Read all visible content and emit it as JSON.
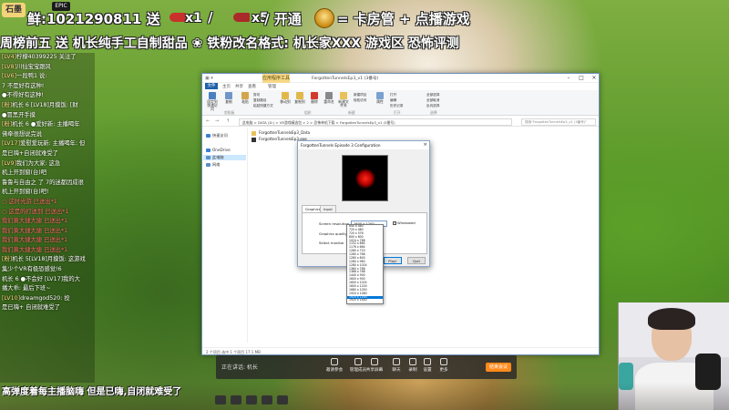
{
  "stream": {
    "logo_text": "石墨",
    "epic_tag": "EPIC",
    "banner_gift": "鲜:1021290811 送",
    "gift1_count": "x1",
    "slash": "/",
    "gift2_count": "x5",
    "open_label": "/ 开通",
    "open_reward": "= 卡房管 + 点播游戏",
    "line2": "周榜前五 送 机长纯手工自制甜品 ❀ 铁粉改名格式: 机长家XXX 游戏区 恐怖评测",
    "bottom_message": "高弹度着每主播脑嗨 但是已嗨,自闭就难受了"
  },
  "chat": [
    {
      "lv": "[LV4]",
      "text": "柠檬40399225 关注了"
    },
    {
      "lv": "[LV8]",
      "text": "川仙宝宝跟风"
    },
    {
      "lv": "[LV6]",
      "text": "一段鸭1 说:"
    },
    {
      "lv": "",
      "text": "  7 不是好有这种!"
    },
    {
      "lv": "",
      "text": "  ●不得好有这种!"
    },
    {
      "lv": "[粉]",
      "text": "机长 6 [LV18]月摸饭: [财"
    },
    {
      "lv": "",
      "text": "  ●冒黑开手摸"
    },
    {
      "lv": "[粉]",
      "text": "机长 6 ●爱好新: 主播喝年"
    },
    {
      "lv": "",
      "text": "  佛牵很想说完说"
    },
    {
      "lv": "[LV17]",
      "text": "爱慰爱玩新: 主播喝年: 但"
    },
    {
      "lv": "",
      "text": "  是已嗨+自闭就难受了"
    },
    {
      "lv": "[LV9]",
      "text": "我们为大家: 这急"
    },
    {
      "lv": "",
      "text": "  机上开到窗(台)吧"
    },
    {
      "lv": "",
      "text": "  鲁鲁与自由之 了 7的迷都因成很"
    },
    {
      "lv": "",
      "text": "  机上开到窗(台)吧!"
    },
    {
      "lv": "",
      "text": " "
    },
    {
      "lv": "",
      "text": "  ○ 这时光游 已送出*1"
    },
    {
      "lv": "",
      "text": "  ○ 这是的打送到 已送出*1"
    },
    {
      "lv": "",
      "text": "  我们黄大捷大捷 已送出*1"
    },
    {
      "lv": "",
      "text": "  我们黄大捷大捷 已送出*1"
    },
    {
      "lv": "",
      "text": "  我们黄大捷大捷 已送出*1"
    },
    {
      "lv": "",
      "text": "  我们黄大捷大捷 已送出*1"
    },
    {
      "lv": "",
      "text": " "
    },
    {
      "lv": "[粉]",
      "text": "机长 5[LV18]月摸饭: 这游戏"
    },
    {
      "lv": "",
      "text": "  集少个VR有极恐感觉!6"
    },
    {
      "lv": "",
      "text": "  机长 6 ●不会好 [LV17]我的大"
    },
    {
      "lv": "",
      "text": "  播大乖: 最后下班~"
    },
    {
      "lv": "[LV10]",
      "text": "dreamgod520: 投"
    },
    {
      "lv": "",
      "text": "  是已嗨+ 自闭就难受了"
    }
  ],
  "explorer": {
    "title": "ForgottenTunnelsEp3_v1 (3番号)",
    "ctx_tab": "应用程序工具",
    "ribbon_tabs": {
      "file": "文件",
      "home": "主页",
      "share": "共享",
      "view": "查看",
      "manage": "管理"
    },
    "ribbon_buttons": [
      {
        "label": "固定到快速访问",
        "color": "#4a7fc1"
      },
      {
        "label": "复制",
        "color": "#6e96c8"
      },
      {
        "label": "粘贴",
        "color": "#d3a64a"
      },
      {
        "label": "移动到",
        "color": "#e0b84a"
      },
      {
        "label": "复制到",
        "color": "#e0b84a"
      },
      {
        "label": "删除",
        "color": "#d33a2c"
      },
      {
        "label": "重命名",
        "color": "#888"
      },
      {
        "label": "新建文件夹",
        "color": "#e8c15a"
      },
      {
        "label": "属性",
        "color": "#7aa0d0"
      }
    ],
    "ribbon_small": [
      "剪切",
      "复制路径",
      "粘贴快捷方式",
      "新建项目",
      "轻松访问",
      "打开",
      "编辑",
      "历史记录",
      "全部选择",
      "全部取消",
      "反向选择"
    ],
    "ribbon_groups": [
      "剪贴板",
      "组织",
      "新建",
      "打开",
      "选择"
    ],
    "nav_buttons": {
      "back": "←",
      "forward": "→",
      "up": "↑"
    },
    "address": "此电脑 > DATA (D:) > VR游戏精选包 > 2 > 恐怖单机下载 > ForgottenTunnelsEp3_v1 (3番号)",
    "search_placeholder": "搜索\"ForgottenTunnelsEp3_v1 (3番号)\"",
    "nav_items": [
      {
        "label": "快速访问",
        "color": "#3a7fd0"
      },
      {
        "label": "OneDrive",
        "color": "#3a7fd0"
      },
      {
        "label": "此电脑",
        "color": "#5c8ec9"
      },
      {
        "label": "网络",
        "color": "#5c8ec9"
      }
    ],
    "files": [
      {
        "name": "ForgottenTunnelsEp3_Data",
        "color": "#e8c15a"
      },
      {
        "name": "ForgottenTunnelsEp3.exe",
        "color": "#333"
      }
    ],
    "status": "2 个项目  选中 1 个项目  17.1 MB",
    "window_controls": {
      "min": "–",
      "max": "□",
      "close": "×"
    }
  },
  "config": {
    "title": "ForgottenTunnels Episode 3 Configuration",
    "close": "×",
    "tabs": [
      "Graphics",
      "Input"
    ],
    "labels": {
      "resolution": "Screen resolution",
      "quality": "Graphics quality",
      "monitor": "Select monitor"
    },
    "resolution_value": "1600 x 1200",
    "windowed_label": "Windowed",
    "windowed_mark": "✓",
    "buttons": {
      "play": "Play!",
      "quit": "Quit"
    },
    "resolutions": [
      "640 x 480",
      "720 x 480",
      "720 x 576",
      "800 x 600",
      "1024 x 768",
      "1152 x 864",
      "1176 x 664",
      "1280 x 720",
      "1280 x 768",
      "1280 x 800",
      "1280 x 960",
      "1280 x 1024",
      "1360 x 768",
      "1366 x 768",
      "1440 x 900",
      "1600 x 900",
      "1600 x 1024",
      "1600 x 1200",
      "1680 x 1050",
      "1920 x 1080",
      "1920 x 1200",
      "1920 x 1440"
    ],
    "selected_index": 20
  },
  "meeting": {
    "info_text": "正在讲话: 机长",
    "tools": [
      "邀请参会",
      "管理成员",
      "共享屏幕",
      "聊天",
      "录制",
      "设置",
      "更多"
    ],
    "end_label": "结束会议"
  }
}
